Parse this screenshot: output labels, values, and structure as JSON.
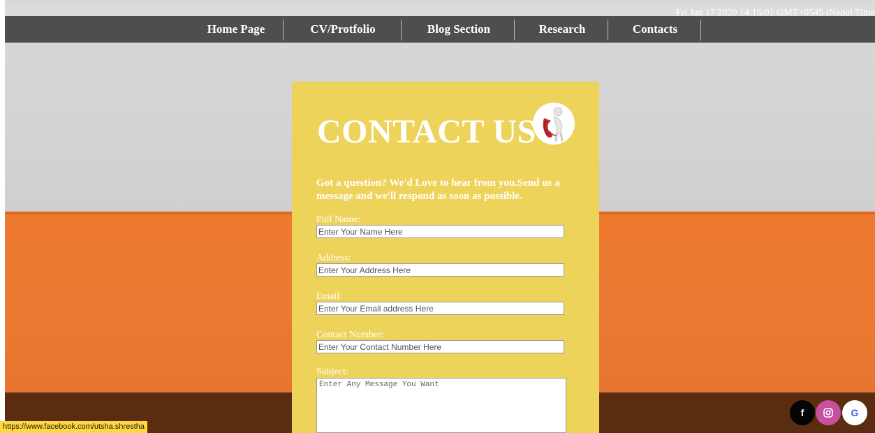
{
  "clock": {
    "text": "Fri Jan 17 2020 14:16:01 GMT+0545 (Nepal Time"
  },
  "nav": {
    "items": [
      "Home Page",
      "CV/Protfolio",
      "Blog Section",
      "Research",
      "Contacts"
    ]
  },
  "contact": {
    "title": "CONTACT US",
    "intro": "Got a question? We'd Love to hear from you.Send us a message and we'll respond as soon as possible.",
    "fields": {
      "name": {
        "label": "Full Name:",
        "placeholder": "Enter Your Name Here"
      },
      "address": {
        "label": "Address:",
        "placeholder": "Enter Your Address Here"
      },
      "email": {
        "label": "Email:",
        "placeholder": "Enter Your Email address Here"
      },
      "phone": {
        "label": "Contact Number:",
        "placeholder": "Enter Your Contact Number Here"
      },
      "subject": {
        "label": "Subject:",
        "placeholder": "Enter Any Message You Want"
      }
    }
  },
  "status_bar": {
    "url": "https://www.facebook.com/utsha.shrestha"
  },
  "social": {
    "facebook_glyph": "f",
    "google_glyph": "G",
    "colors": {
      "facebook": "#050505",
      "instagram": "#c94fa0",
      "google_text": "#3b5bdb"
    }
  },
  "theme": {
    "navbar": "#4e4e4e",
    "card": "#eed35a",
    "orange": "#ec7a32",
    "brown": "#5a2c10"
  }
}
